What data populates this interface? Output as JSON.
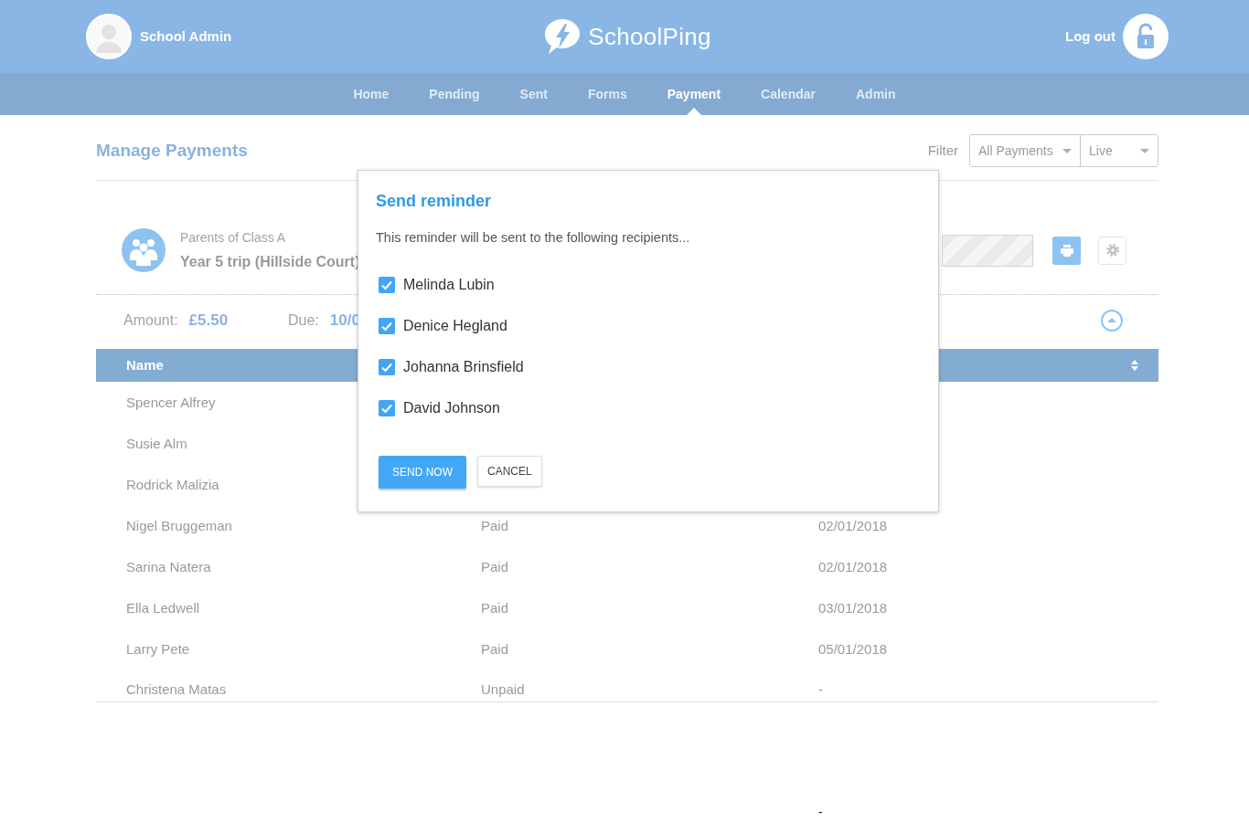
{
  "header": {
    "user_name": "School Admin",
    "logo_text": "SchoolPing",
    "logout": "Log out"
  },
  "nav": [
    {
      "label": "Home",
      "selected": false
    },
    {
      "label": "Pending",
      "selected": false
    },
    {
      "label": "Sent",
      "selected": false
    },
    {
      "label": "Forms",
      "selected": false
    },
    {
      "label": "Payment",
      "selected": true
    },
    {
      "label": "Calendar",
      "selected": false
    },
    {
      "label": "Admin",
      "selected": false
    }
  ],
  "page": {
    "title": "Manage Payments",
    "filter_label": "Filter",
    "filters": [
      "All Payments",
      "Live"
    ]
  },
  "payment": {
    "audience": "Parents of Class A",
    "title": "Year 5 trip (Hillside Court)",
    "amount_label": "Amount:",
    "amount": "£5.50",
    "due_label": "Due:",
    "due": "10/0"
  },
  "table": {
    "columns": [
      "Name"
    ],
    "rows": [
      {
        "name": "Spencer Alfrey"
      },
      {
        "name": "Susie Alm"
      },
      {
        "name": "Rodrick Malizia"
      },
      {
        "name": "Nigel Bruggeman",
        "status": "Paid",
        "date": "02/01/2018"
      },
      {
        "name": "Sarina Natera",
        "status": "Paid",
        "date": "02/01/2018"
      },
      {
        "name": "Ella Ledwell",
        "status": "Paid",
        "date": "03/01/2018"
      },
      {
        "name": "Larry Pete",
        "status": "Paid",
        "date": "05/01/2018"
      },
      {
        "name": "Christena Matas",
        "status": "Unpaid",
        "date": "-"
      }
    ]
  },
  "modal": {
    "open": true,
    "title": "Send reminder",
    "message": "This reminder will be sent to the following recipients...",
    "recipients": [
      {
        "name": "Melinda Lubin",
        "checked": true
      },
      {
        "name": "Denice Hegland",
        "checked": true
      },
      {
        "name": "Johanna Brinsfield",
        "checked": true
      },
      {
        "name": "David Johnson",
        "checked": true
      }
    ],
    "buttons": [
      {
        "label": "SEND NOW",
        "kind": "primary"
      },
      {
        "label": "CANCEL",
        "kind": "secondary"
      }
    ]
  },
  "footer_text": "-"
}
